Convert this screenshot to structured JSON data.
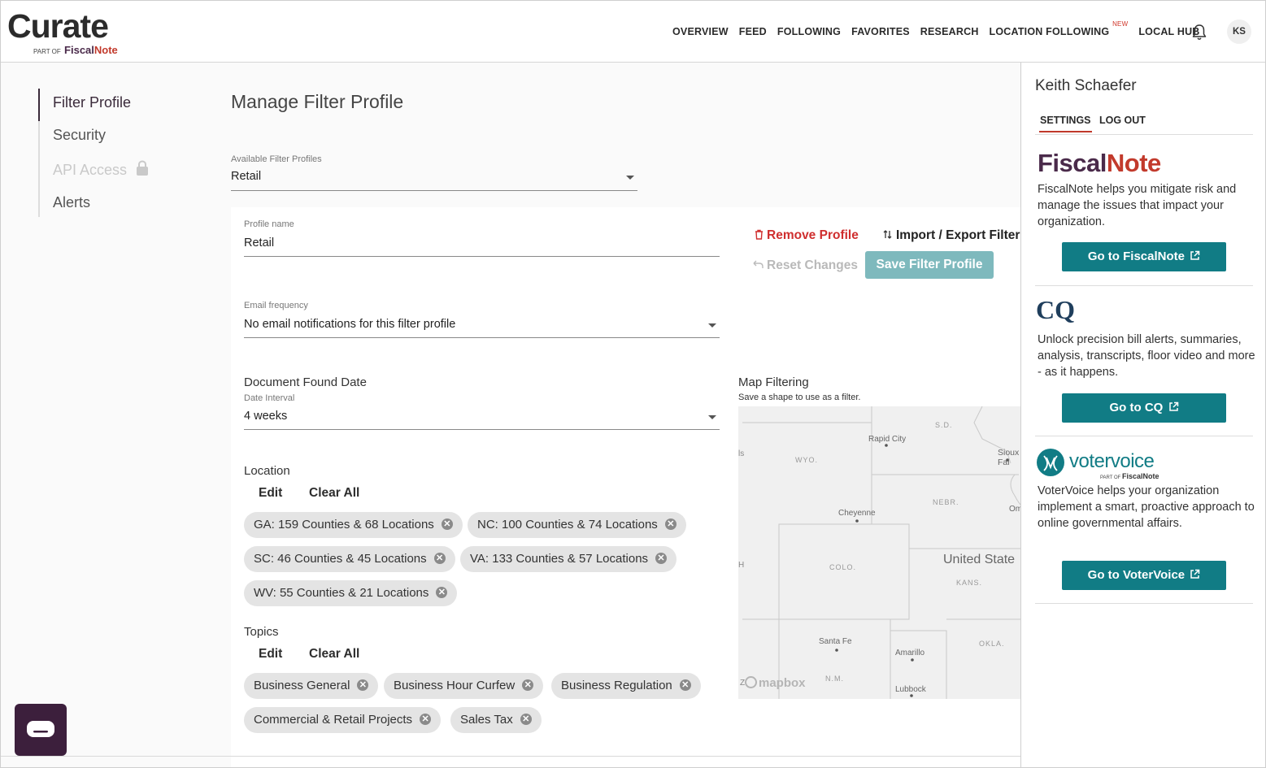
{
  "brand": {
    "name": "Curate",
    "part_of": "PART OF",
    "parent_fiscal": "Fiscal",
    "parent_note": "Note"
  },
  "nav": {
    "items": [
      "OVERVIEW",
      "FEED",
      "FOLLOWING",
      "FAVORITES",
      "RESEARCH",
      "LOCATION FOLLOWING",
      "LOCAL HUB"
    ],
    "new_badge": "NEW",
    "avatar_initials": "KS"
  },
  "side_menu": {
    "items": [
      "Filter Profile",
      "Security",
      "API Access",
      "Alerts"
    ]
  },
  "main": {
    "title": "Manage Filter Profile",
    "available_profiles": {
      "label": "Available Filter Profiles",
      "value": "Retail"
    },
    "profile_name": {
      "label": "Profile name",
      "value": "Retail"
    },
    "actions": {
      "remove": "Remove Profile",
      "import_export": "Import / Export Filter",
      "reset": "Reset Changes",
      "save": "Save Filter Profile"
    },
    "email_frequency": {
      "label": "Email frequency",
      "value": "No email notifications for this filter profile"
    },
    "date": {
      "section": "Document Found Date",
      "label": "Date Interval",
      "value": "4 weeks"
    },
    "location": {
      "title": "Location",
      "edit": "Edit",
      "clear": "Clear All",
      "chips": [
        "GA: 159 Counties & 68 Locations",
        "NC: 100 Counties & 74 Locations",
        "SC: 46 Counties & 45 Locations",
        "VA: 133 Counties & 57 Locations",
        "WV: 55 Counties & 21 Locations"
      ]
    },
    "topics": {
      "title": "Topics",
      "edit": "Edit",
      "clear": "Clear All",
      "chips": [
        "Business General",
        "Business Hour Curfew",
        "Business Regulation",
        "Commercial & Retail Projects",
        "Sales Tax"
      ]
    },
    "map": {
      "title": "Map Filtering",
      "subtitle": "Save a shape to use as a filter.",
      "labels": [
        "S.D.",
        "Rapid City",
        "Sioux Fal",
        "WYO.",
        "NEBR.",
        "Cheyenne",
        "Om",
        "COLO.",
        "United State",
        "KANS.",
        "Santa Fe",
        "Amarillo",
        "OKLA.",
        "N.M.",
        "Lubbock",
        "ls",
        "H",
        "Z"
      ],
      "attribution": "mapbox"
    }
  },
  "panel": {
    "user_name": "Keith Schaefer",
    "tabs": [
      "SETTINGS",
      "LOG OUT"
    ],
    "fiscalnote": {
      "logo_fiscal": "Fiscal",
      "logo_note": "Note",
      "desc": "FiscalNote helps you mitigate risk and manage the issues that impact your organization.",
      "button": "Go to FiscalNote"
    },
    "cq": {
      "logo": "CQ",
      "desc": "Unlock precision bill alerts, summaries, analysis, transcripts, floor video and more - as it happens.",
      "button": "Go to CQ"
    },
    "votervoice": {
      "logo": "votervoice",
      "logo_part_of": "PART OF",
      "logo_fiscalnote": "FiscalNote",
      "desc": "VoterVoice helps your organization implement a smart, proactive approach to online governmental affairs.",
      "button": "Go to VoterVoice"
    }
  },
  "colors": {
    "accent_teal": "#117c85",
    "save_disabled": "#7eb9bd",
    "danger": "#cf2e2e",
    "brand_purple": "#3c1f3c",
    "fiscal_red": "#c23a2c"
  }
}
